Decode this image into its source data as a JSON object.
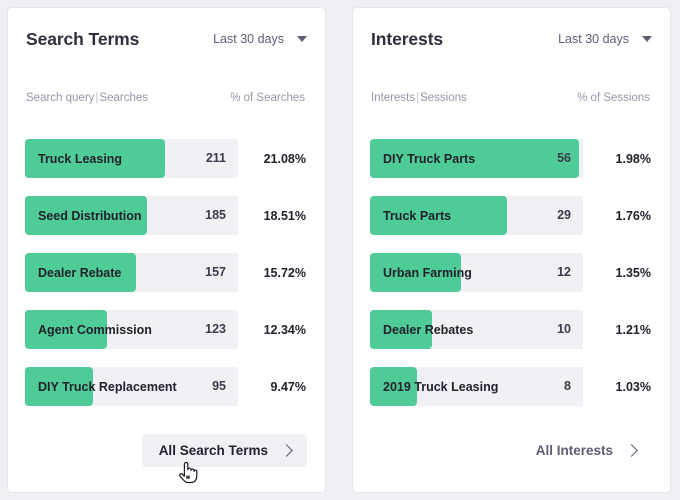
{
  "page": {
    "background": "#eff0f4",
    "accent_green": "#4fcb97",
    "track_gray": "#f0f0f5"
  },
  "cards": [
    {
      "id": "search-terms",
      "title": "Search Terms",
      "range_label": "Last 30 days",
      "col_left_primary": "Search query",
      "col_left_secondary": "Searches",
      "col_right": "% of Searches",
      "footer_label": "All Search Terms",
      "footer_hovered": true,
      "rows": [
        {
          "label": "Truck Leasing",
          "value": "211",
          "percent": "21.08%",
          "bar_width_pct": 65.7
        },
        {
          "label": "Seed Distribution",
          "value": "185",
          "percent": "18.51%",
          "bar_width_pct": 57.3
        },
        {
          "label": "Dealer Rebate",
          "value": "157",
          "percent": "15.72%",
          "bar_width_pct": 52.1
        },
        {
          "label": "Agent Commission",
          "value": "123",
          "percent": "12.34%",
          "bar_width_pct": 38.5
        },
        {
          "label": "DIY Truck Replacement",
          "value": "95",
          "percent": "9.47%",
          "bar_width_pct": 31.9
        }
      ]
    },
    {
      "id": "interests",
      "title": "Interests",
      "range_label": "Last 30 days",
      "col_left_primary": "Interests",
      "col_left_secondary": "Sessions",
      "col_right": "% of Sessions",
      "footer_label": "All Interests",
      "footer_hovered": false,
      "rows": [
        {
          "label": "DIY Truck Parts",
          "value": "56",
          "percent": "1.98%",
          "bar_width_pct": 98.0
        },
        {
          "label": "Truck Parts",
          "value": "29",
          "percent": "1.76%",
          "bar_width_pct": 64.5
        },
        {
          "label": "Urban Farming",
          "value": "12",
          "percent": "1.35%",
          "bar_width_pct": 42.5
        },
        {
          "label": "Dealer Rebates",
          "value": "10",
          "percent": "1.21%",
          "bar_width_pct": 29.0
        },
        {
          "label": "2019 Truck Leasing",
          "value": "8",
          "percent": "1.03%",
          "bar_width_pct": 22.0
        }
      ]
    }
  ],
  "chart_data": [
    {
      "type": "bar",
      "title": "Search Terms",
      "subtitle": "Last 30 days",
      "xlabel": "Searches",
      "ylabel": "Search query",
      "categories": [
        "Truck Leasing",
        "Seed Distribution",
        "Dealer Rebate",
        "Agent Commission",
        "DIY Truck Replacement"
      ],
      "values": [
        211,
        185,
        157,
        123,
        95
      ],
      "percent_values": [
        21.08,
        18.51,
        15.72,
        12.34,
        9.47
      ],
      "value_labels": [
        "211",
        "185",
        "157",
        "123",
        "95"
      ],
      "percent_labels": [
        "21.08%",
        "18.51%",
        "15.72%",
        "12.34%",
        "9.47%"
      ],
      "orientation": "horizontal",
      "grid": false,
      "legend": "none",
      "bar_color": "#4fcb97",
      "track_color": "#f0f0f5"
    },
    {
      "type": "bar",
      "title": "Interests",
      "subtitle": "Last 30 days",
      "xlabel": "Sessions",
      "ylabel": "Interests",
      "categories": [
        "DIY Truck Parts",
        "Truck Parts",
        "Urban Farming",
        "Dealer Rebates",
        "2019 Truck Leasing"
      ],
      "values": [
        56,
        29,
        12,
        10,
        8
      ],
      "percent_values": [
        1.98,
        1.76,
        1.35,
        1.21,
        1.03
      ],
      "value_labels": [
        "56",
        "29",
        "12",
        "10",
        "8"
      ],
      "percent_labels": [
        "1.98%",
        "1.76%",
        "1.35%",
        "1.21%",
        "1.03%"
      ],
      "orientation": "horizontal",
      "grid": false,
      "legend": "none",
      "bar_color": "#4fcb97",
      "track_color": "#f0f0f5"
    }
  ]
}
